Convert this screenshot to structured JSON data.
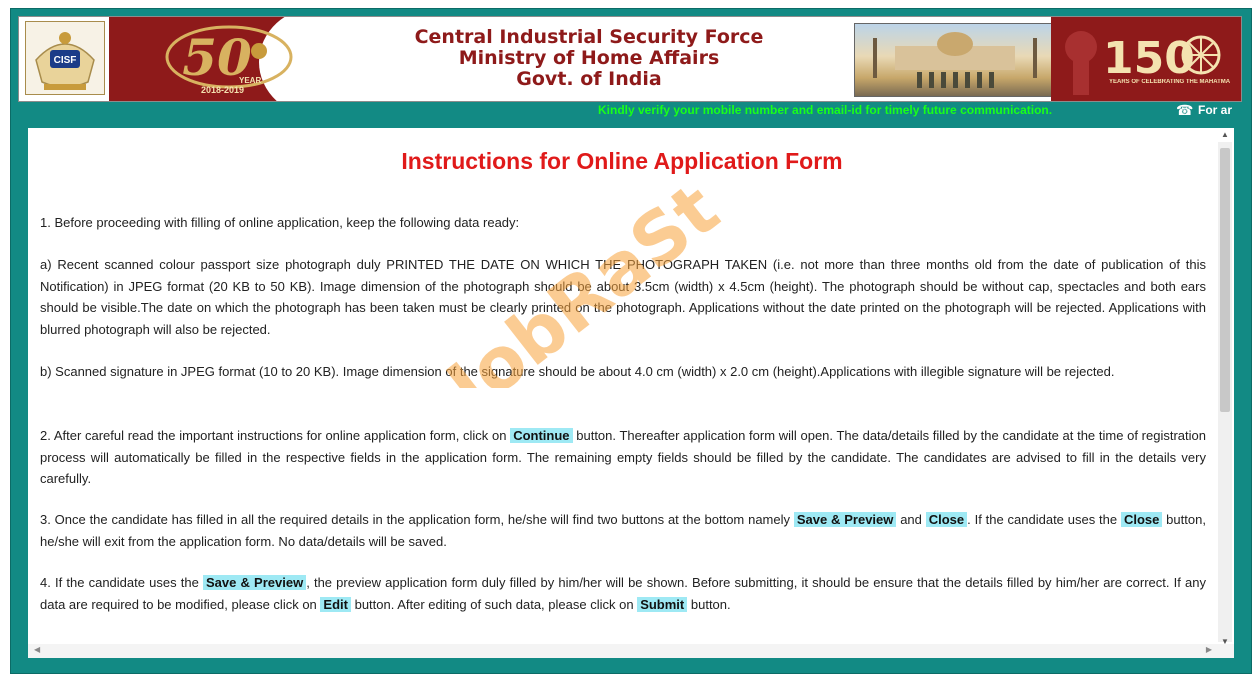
{
  "header": {
    "title_lines": [
      "Central Industrial Security Force",
      "Ministry of Home Affairs",
      "Govt. of India"
    ],
    "logo_text": "CISF",
    "anniversary_number": "50",
    "anniversary_word": "YEAR",
    "anniversary_years": "2018-2019",
    "right_number": "150",
    "right_caption": "YEARS OF CELEBRATING THE MAHATMA"
  },
  "ticker": {
    "text": "Kindly verify your mobile number and email-id for timely future communication.",
    "phone_icon": "telephone-icon",
    "extra_text": "For ar"
  },
  "watermark": "JobRaSt",
  "main": {
    "title": "Instructions for Online Application Form",
    "p1": "1. Before proceeding with filling of online application, keep the following data ready:",
    "p2": "a) Recent scanned colour passport size photograph duly PRINTED THE DATE ON WHICH THE PHOTOGRAPH TAKEN (i.e. not more than three months old from the date of publication of this Notification) in JPEG format (20 KB to 50 KB). Image dimension of the photograph should be about 3.5cm (width) x 4.5cm (height). The photograph should be without cap, spectacles and both ears should be visible.The date on which the photograph has been taken must be clearly printed on the photograph. Applications without the date printed on the photograph will be rejected. Applications with blurred photograph will also be rejected.",
    "p3": "b) Scanned signature in JPEG format (10 to 20 KB). Image dimension of the signature should be about 4.0 cm (width) x 2.0 cm (height).Applications with illegible signature will be rejected.",
    "p4a": "2. After careful read the important instructions for online application form, click on",
    "p4_btn": "Continue",
    "p4b": "button. Thereafter application form will open. The data/details filled by the candidate at the time of registration process will automatically be filled in the respective fields in the application form. The remaining empty fields should be filled by the candidate. The candidates are advised to fill in the details very carefully.",
    "p5a": "3. Once the candidate has filled in all the required details in the application form, he/she will find two buttons at the bottom namely",
    "p5_btn1": "Save & Preview",
    "p5b": "and",
    "p5_btn2": "Close",
    "p5c": ". If the candidate uses the",
    "p5_btn3": "Close",
    "p5d": "button, he/she will exit from the application form. No data/details will be saved.",
    "p6a": "4. If the candidate uses the",
    "p6_btn1": "Save & Preview",
    "p6b": ", the preview application form duly filled by him/her will be shown. Before submitting, it should be ensure that the details filled by him/her are correct. If any data are required to be modified, please click on",
    "p6_btn2": "Edit",
    "p6c": "button. After editing of such data, please click on",
    "p6_btn3": "Submit",
    "p6d": "button."
  },
  "colors": {
    "frame": "#128a84",
    "banner": "#8e1a1a",
    "title_red": "#e01a1a",
    "ticker_green": "#19ff19",
    "highlight": "#9ee9f4"
  }
}
